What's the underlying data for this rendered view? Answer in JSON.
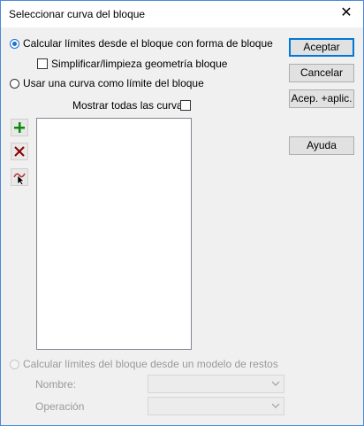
{
  "window": {
    "title": "Seleccionar curva del bloque",
    "close_glyph": "✕"
  },
  "options": {
    "calc_from_block": "Calcular límites desde el bloque con forma de bloque",
    "simplify_geometry": "Simplificar/limpieza geometría bloque",
    "use_curve": "Usar una curva como límite del bloque",
    "show_all_curves": "Mostrar todas las curvas",
    "calc_from_remains": "Calcular límites del bloque desde un modelo de restos"
  },
  "buttons": {
    "accept": "Aceptar",
    "cancel": "Cancelar",
    "accept_apply": "Acep. +aplic.",
    "help": "Ayuda"
  },
  "fields": {
    "name_label": "Nombre:",
    "name_value": "",
    "operation_label": "Operación",
    "operation_value": ""
  },
  "tools": [
    {
      "icon": "add-icon"
    },
    {
      "icon": "delete-icon"
    },
    {
      "icon": "pick-curve-icon"
    }
  ],
  "colors": {
    "accent": "#0078d7",
    "add": "#0a8a0a",
    "delete": "#8b0000"
  },
  "state": {
    "selected_radio": "calc_from_block",
    "simplify_checked": false,
    "show_all_checked": false,
    "remains_enabled": false
  }
}
